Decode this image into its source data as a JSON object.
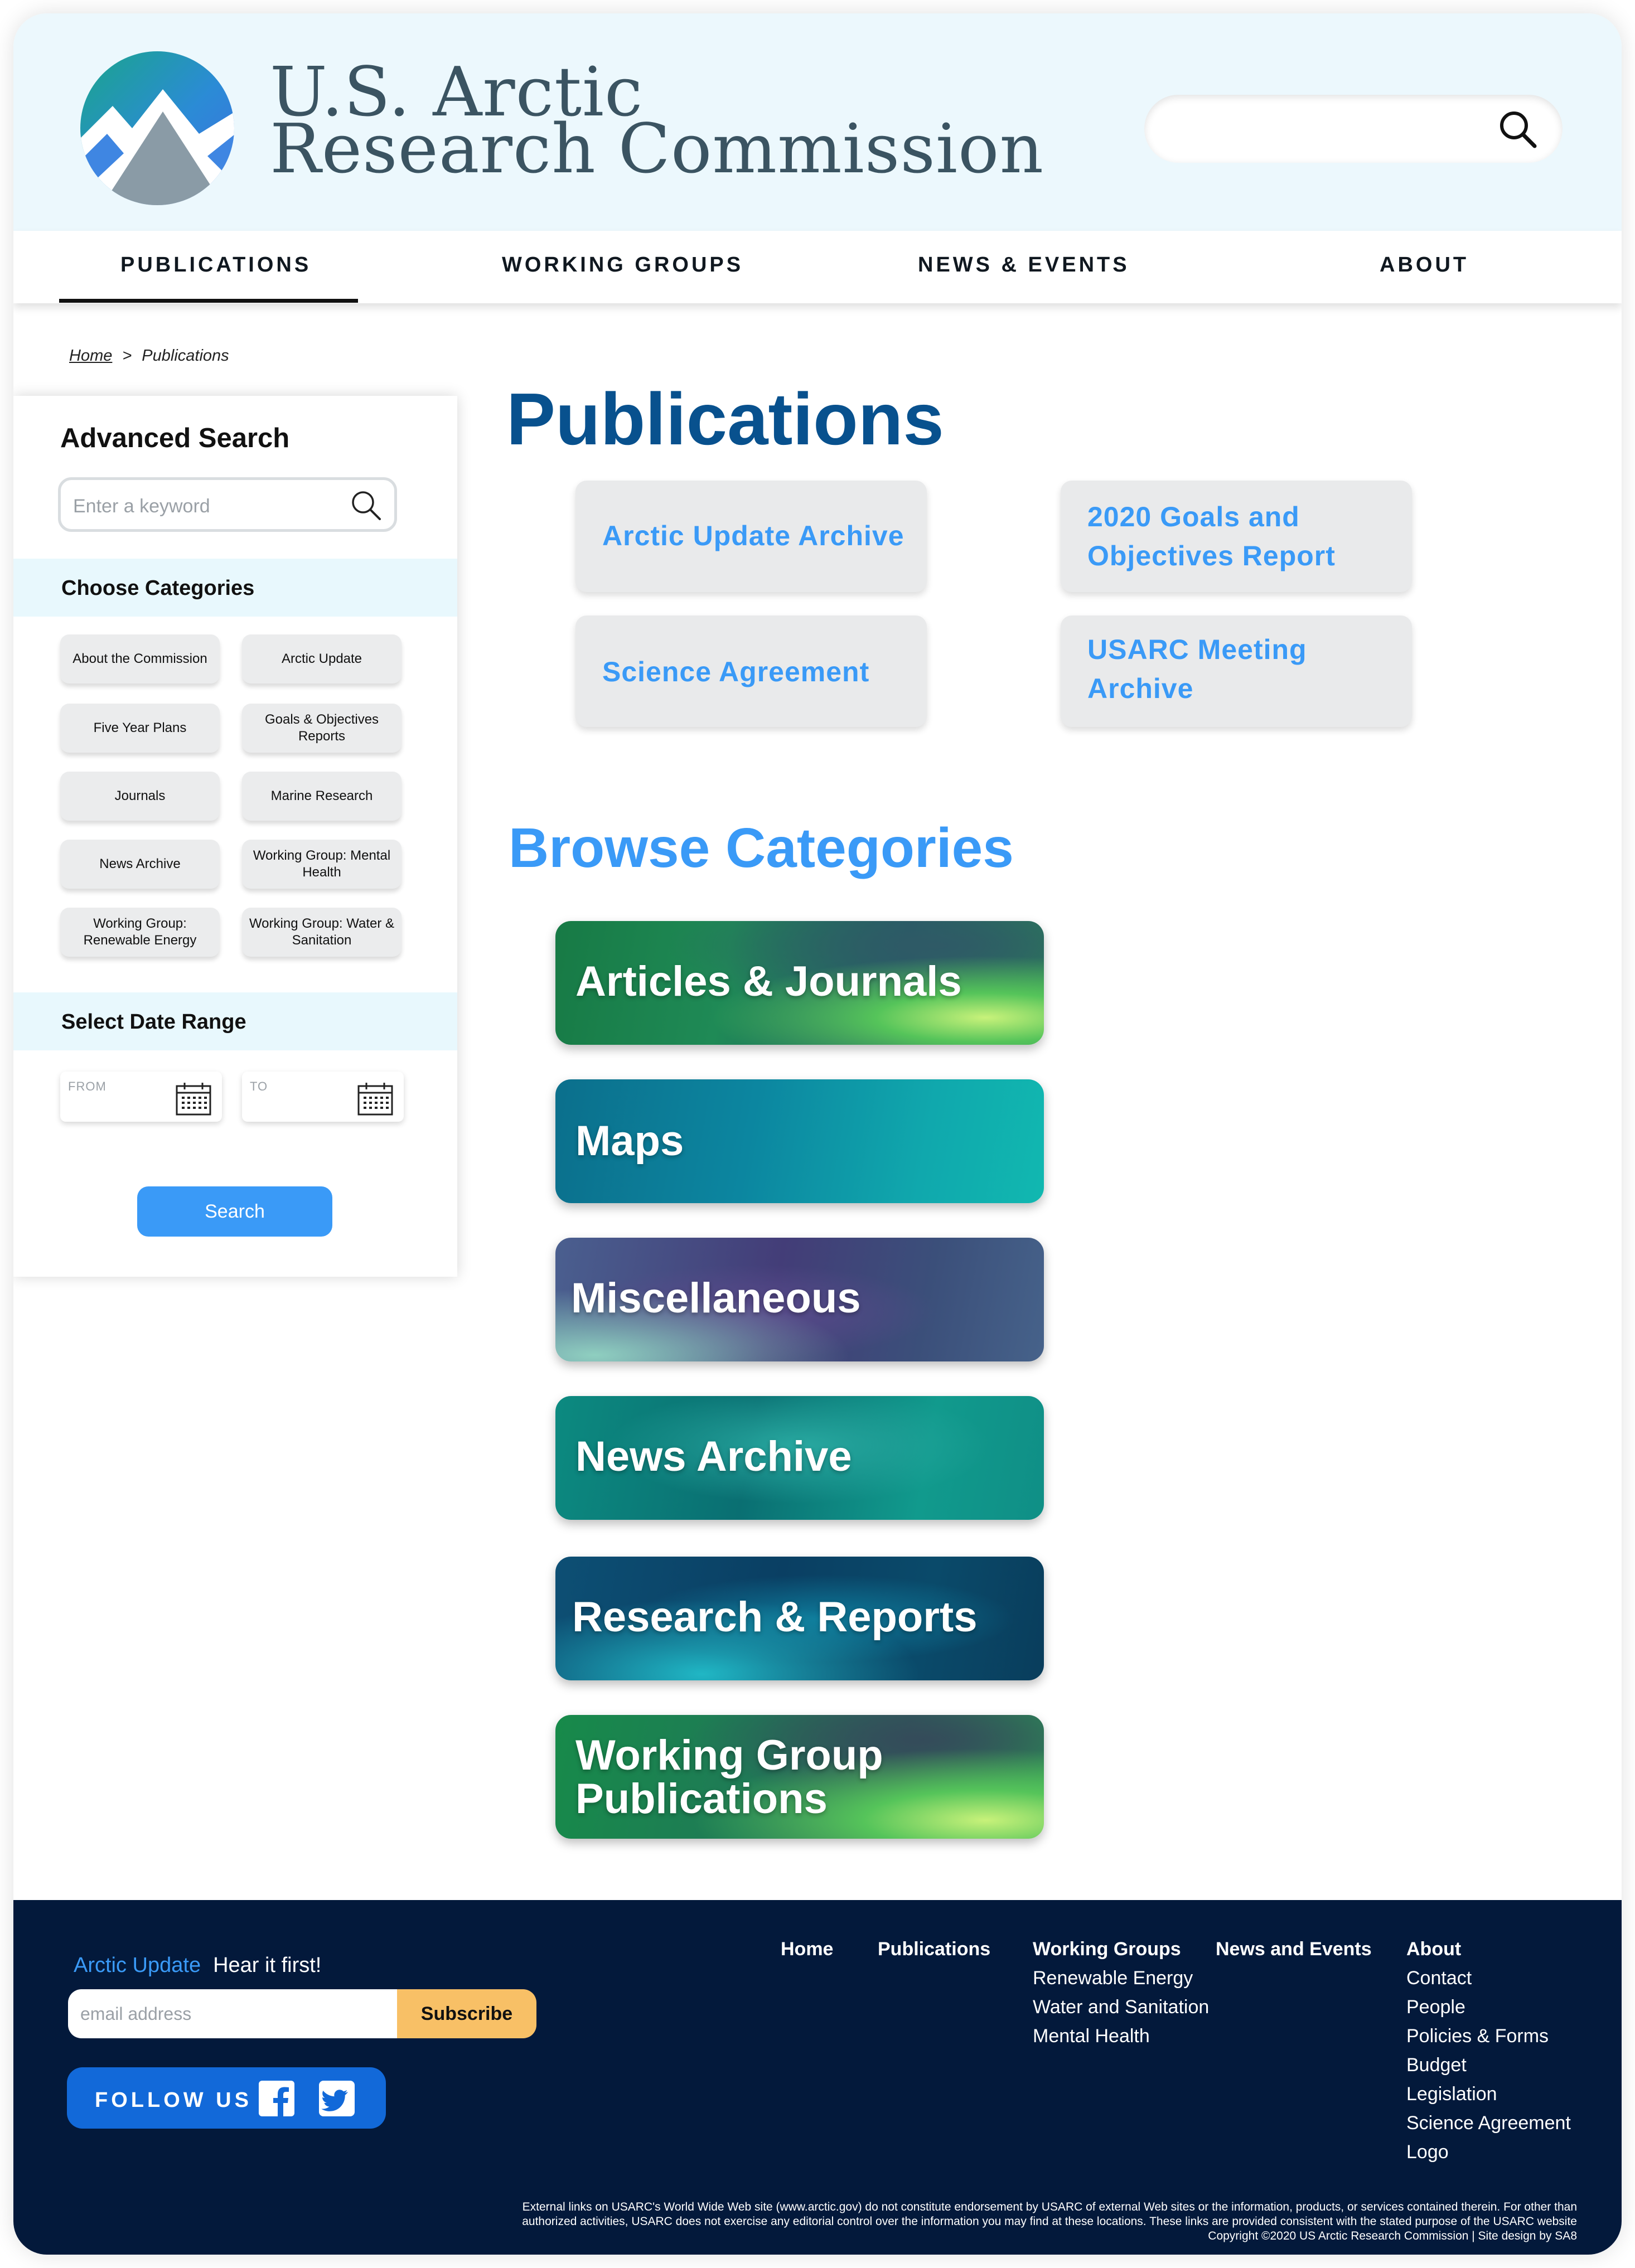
{
  "header": {
    "org_line1": "U.S. Arctic",
    "org_line2": "Research Commission"
  },
  "nav": {
    "items": [
      "PUBLICATIONS",
      "WORKING GROUPS",
      "NEWS & EVENTS",
      "ABOUT"
    ],
    "active": "PUBLICATIONS"
  },
  "breadcrumb": {
    "home": "Home",
    "separator": ">",
    "current": "Publications"
  },
  "sidebar": {
    "title": "Advanced Search",
    "search_placeholder": "Enter a keyword",
    "categories_heading": "Choose Categories",
    "categories": [
      "About the Commission",
      "Arctic Update",
      "Five Year Plans",
      "Goals & Objectives Reports",
      "Journals",
      "Marine Research",
      "News Archive",
      "Working Group: Mental Health",
      "Working Group: Renewable Energy",
      "Working Group: Water & Sanitation"
    ],
    "date_heading": "Select Date Range",
    "from_label": "FROM",
    "to_label": "TO",
    "search_button": "Search"
  },
  "main": {
    "title": "Publications",
    "featured": [
      "Arctic Update Archive",
      "2020 Goals and Objectives Report",
      "Science Agreement",
      "USARC Meeting Archive"
    ],
    "browse_title": "Browse Categories",
    "browse": [
      "Articles & Journals",
      "Maps",
      "Miscellaneous",
      "News Archive",
      "Research & Reports",
      "Working Group Publications"
    ]
  },
  "footer": {
    "arctic_update": "Arctic Update",
    "tagline": "Hear it first!",
    "email_placeholder": "email address",
    "subscribe": "Subscribe",
    "follow": "FOLLOW US",
    "col_home": "Home",
    "col_publications": "Publications",
    "col_working_groups": {
      "heading": "Working Groups",
      "items": [
        "Renewable Energy",
        "Water and Sanitation",
        "Mental Health"
      ]
    },
    "col_news": "News and Events",
    "col_about": {
      "heading": "About",
      "items": [
        "Contact",
        "People",
        "Policies  & Forms",
        "Budget",
        "Legislation",
        "Science Agreement",
        "Logo"
      ]
    },
    "legal_1": "External links on USARC's World Wide Web site (www.arctic.gov) do not constitute endorsement by USARC of external Web sites or the information, products, or services contained therein. For other than",
    "legal_2": "authorized activities, USARC does not exercise any editorial control over the information you may find at these locations. These links are provided consistent with the stated purpose of the USARC website",
    "legal_3": "Copyright ©2020 US Arctic Research Commission | Site design by SA8"
  },
  "colors": {
    "header_bg": "#ecf8fd",
    "brand_dark": "#08518e",
    "accent_blue": "#3a9af7",
    "footer_bg": "#03193b",
    "subscribe": "#f8c066"
  },
  "icons": [
    "logo-mountain-icon",
    "search-icon",
    "calendar-icon",
    "facebook-icon",
    "twitter-icon"
  ]
}
